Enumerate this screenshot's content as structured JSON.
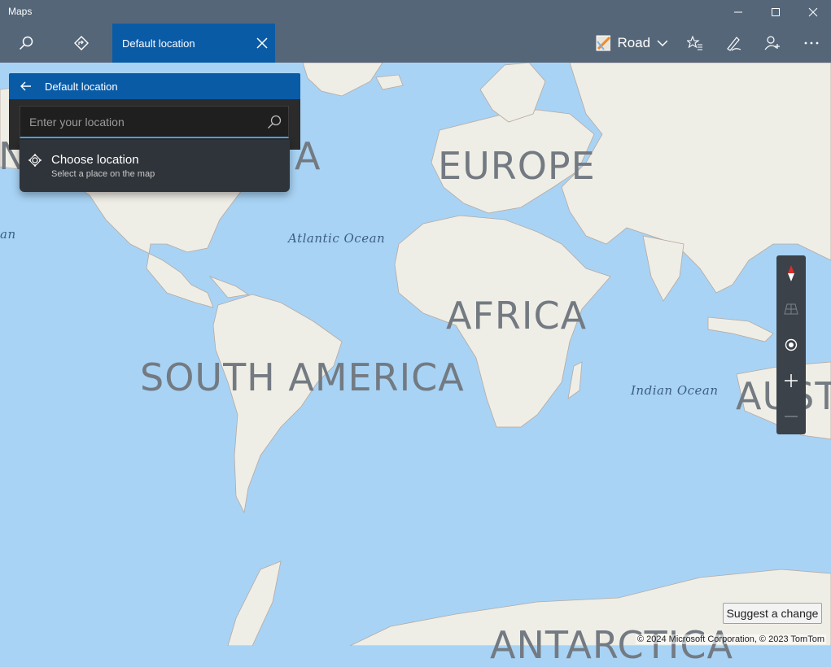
{
  "window": {
    "title": "Maps"
  },
  "toolbar": {
    "active_tab": "Default location",
    "map_style": "Road"
  },
  "panel": {
    "title": "Default location",
    "search_placeholder": "Enter your location",
    "choose_title": "Choose location",
    "choose_subtitle": "Select a place on the map"
  },
  "map": {
    "labels": {
      "north_america_fragment_1": "N",
      "north_america_fragment_2": "A",
      "europe": "EUROPE",
      "africa": "AFRICA",
      "south_america": "SOUTH AMERICA",
      "australia_fragment": "AUST",
      "antarctica_fragment": "ANTARCTICA",
      "atlantic": "Atlantic Ocean",
      "indian": "Indian Ocean",
      "pacific_fragment": "an"
    }
  },
  "footer": {
    "suggest": "Suggest a change",
    "copyright": "© 2024 Microsoft Corporation, © 2023 TomTom"
  },
  "colors": {
    "accent": "#0a5ba6",
    "ocean": "#a8d3f5",
    "land": "#efeee6",
    "titlebar": "#4e5c6e"
  }
}
